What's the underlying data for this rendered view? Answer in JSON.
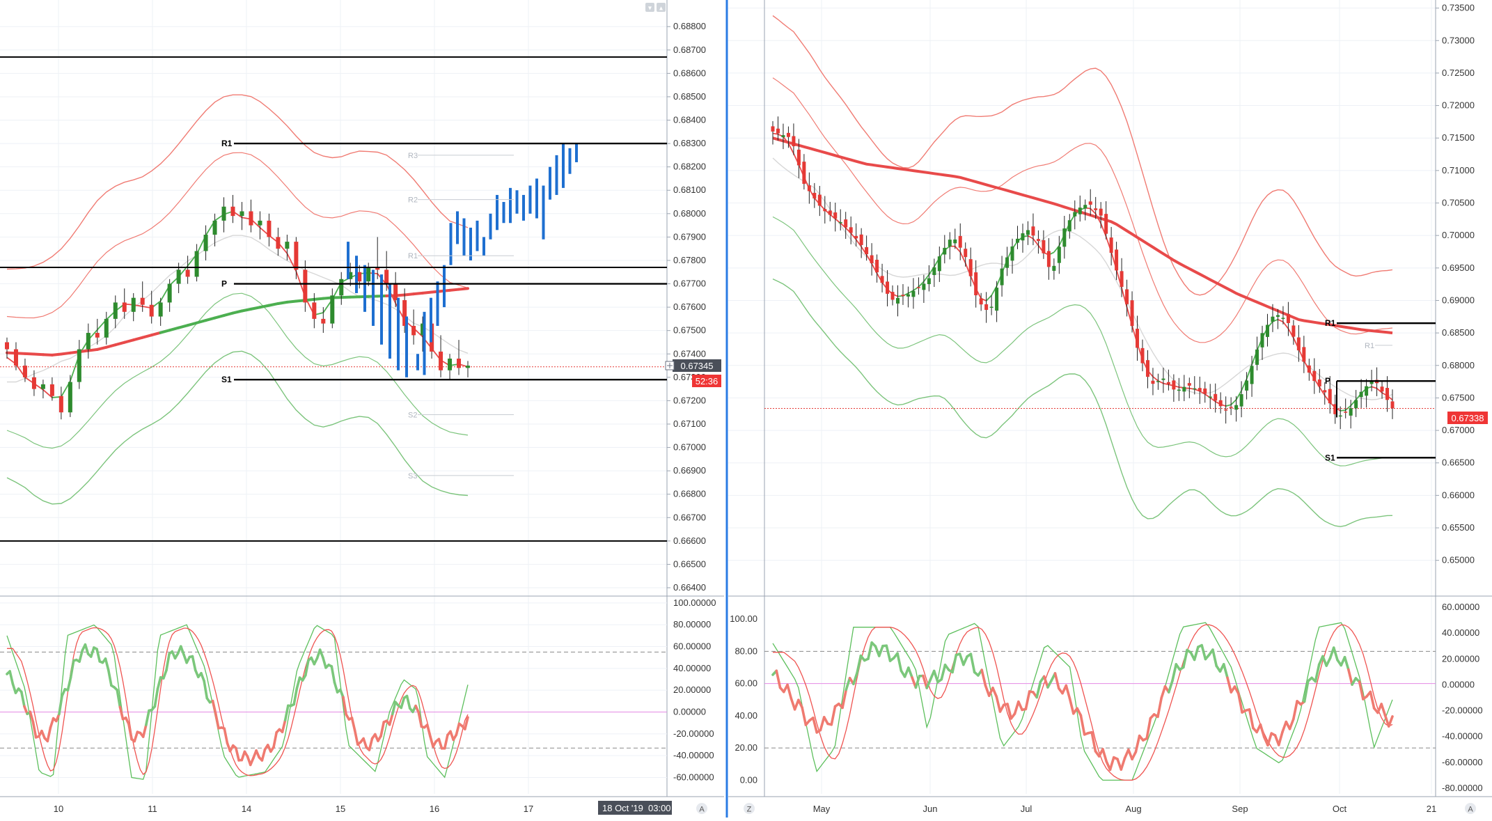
{
  "colors": {
    "background": "#ffffff",
    "grid": "#eef1f6",
    "bull_candle": "#2e8b2e",
    "bear_candle": "#e53935",
    "projection_bars": "#1e6fd0",
    "upper_band": "#f07b73",
    "lower_band": "#7cc47c",
    "ma_red": "#e84a4a",
    "ma_green": "#4caf50",
    "ma_grey": "#d7d7d7",
    "pivot_line": "#000000",
    "price_line": "#e53935",
    "osc_fast_green": "#5cbf5c",
    "osc_fast_red": "#ef5350",
    "osc_thick_green": "#7bc77b",
    "osc_thick_red": "#ef7a70",
    "dash_level": "#888888",
    "mid_level": "#e58ae5",
    "price_tag_bg": "#ef3535",
    "crosshair_tag_bg": "#4a4f59"
  },
  "left_chart": {
    "pair_price_tag": "0.67345",
    "countdown_tag": "52:36",
    "crosshair_time_tag": "18 Oct '19",
    "crosshair_time_sub": "03:00",
    "corner_buttons": [
      "▾",
      "▴"
    ],
    "footer_button": "A"
  },
  "right_chart": {
    "price_tag": "0.67338",
    "footer_left_button": "Z",
    "footer_right_button": "A"
  },
  "chart_data": [
    {
      "name_id": "left-price",
      "type": "line",
      "subtype": "candlestick",
      "x_tick_labels": [
        "10",
        "11",
        "14",
        "15",
        "16",
        "17"
      ],
      "y_tick_labels": [
        "0.68800",
        "0.68700",
        "0.68600",
        "0.68500",
        "0.68400",
        "0.68300",
        "0.68200",
        "0.68100",
        "0.68000",
        "0.67900",
        "0.67800",
        "0.67700",
        "0.67600",
        "0.67500",
        "0.67400",
        "0.67300",
        "0.67200",
        "0.67100",
        "0.67000",
        "0.66900",
        "0.66800",
        "0.66700",
        "0.66600",
        "0.66500",
        "0.66400"
      ],
      "ylim": [
        0.664,
        0.6889
      ],
      "last_price": 0.67345,
      "pivot_levels": [
        {
          "label": "R1",
          "value": 0.683
        },
        {
          "label": "P",
          "value": 0.677
        },
        {
          "label": "S1",
          "value": 0.6729
        }
      ],
      "faint_pivot_labels": [
        {
          "label": "R3",
          "value": 0.6825
        },
        {
          "label": "R2",
          "value": 0.6806
        },
        {
          "label": "R1",
          "value": 0.6782
        },
        {
          "label": "S2",
          "value": 0.6714
        },
        {
          "label": "S3",
          "value": 0.6688
        }
      ],
      "extra_lines": [
        0.6867,
        0.6777,
        0.666
      ],
      "candles_ohlc": [
        [
          0.6745,
          0.6747,
          0.6738,
          0.6742
        ],
        [
          0.6742,
          0.6745,
          0.6733,
          0.6735
        ],
        [
          0.6735,
          0.6738,
          0.6728,
          0.673
        ],
        [
          0.673,
          0.6733,
          0.6722,
          0.6725
        ],
        [
          0.6725,
          0.6729,
          0.6721,
          0.6727
        ],
        [
          0.6727,
          0.673,
          0.672,
          0.6722
        ],
        [
          0.6722,
          0.6726,
          0.6712,
          0.6715
        ],
        [
          0.6715,
          0.6731,
          0.6713,
          0.6728
        ],
        [
          0.6728,
          0.6746,
          0.6725,
          0.6742
        ],
        [
          0.6742,
          0.6753,
          0.6738,
          0.6749
        ],
        [
          0.6749,
          0.6755,
          0.6744,
          0.6747
        ],
        [
          0.6747,
          0.6758,
          0.6744,
          0.6755
        ],
        [
          0.6755,
          0.6765,
          0.6751,
          0.6762
        ],
        [
          0.6762,
          0.6768,
          0.6755,
          0.6758
        ],
        [
          0.6758,
          0.6766,
          0.6754,
          0.6764
        ],
        [
          0.6764,
          0.6771,
          0.6758,
          0.6761
        ],
        [
          0.6761,
          0.6767,
          0.6753,
          0.6756
        ],
        [
          0.6756,
          0.6764,
          0.6752,
          0.6762
        ],
        [
          0.6762,
          0.6772,
          0.6758,
          0.677
        ],
        [
          0.677,
          0.6779,
          0.6766,
          0.6776
        ],
        [
          0.6776,
          0.6782,
          0.677,
          0.6773
        ],
        [
          0.6773,
          0.6787,
          0.6771,
          0.6784
        ],
        [
          0.6784,
          0.6795,
          0.678,
          0.6791
        ],
        [
          0.6791,
          0.68,
          0.6786,
          0.6797
        ],
        [
          0.6797,
          0.6807,
          0.6792,
          0.6803
        ],
        [
          0.6803,
          0.6808,
          0.6796,
          0.6799
        ],
        [
          0.6799,
          0.6805,
          0.6793,
          0.6801
        ],
        [
          0.6801,
          0.6806,
          0.6792,
          0.6795
        ],
        [
          0.6795,
          0.6801,
          0.6789,
          0.6797
        ],
        [
          0.6797,
          0.68,
          0.6786,
          0.679
        ],
        [
          0.679,
          0.6794,
          0.6782,
          0.6785
        ],
        [
          0.6785,
          0.6791,
          0.678,
          0.6788
        ],
        [
          0.6788,
          0.679,
          0.6772,
          0.6776
        ],
        [
          0.6776,
          0.678,
          0.6758,
          0.6762
        ],
        [
          0.6762,
          0.6766,
          0.6751,
          0.6755
        ],
        [
          0.6755,
          0.676,
          0.6749,
          0.6753
        ],
        [
          0.6753,
          0.6768,
          0.6751,
          0.6765
        ],
        [
          0.6765,
          0.6775,
          0.6761,
          0.6772
        ],
        [
          0.6772,
          0.6779,
          0.6769,
          0.6775
        ],
        [
          0.6775,
          0.6778,
          0.6768,
          0.6771
        ],
        [
          0.6771,
          0.6779,
          0.6769,
          0.6777
        ],
        [
          0.6777,
          0.679,
          0.6772,
          0.6776
        ],
        [
          0.6776,
          0.6784,
          0.6767,
          0.677
        ],
        [
          0.677,
          0.6775,
          0.676,
          0.6763
        ],
        [
          0.6763,
          0.6768,
          0.6749,
          0.6752
        ],
        [
          0.6752,
          0.6759,
          0.6744,
          0.6748
        ],
        [
          0.6748,
          0.6756,
          0.6741,
          0.6753
        ],
        [
          0.6753,
          0.6757,
          0.6738,
          0.6741
        ],
        [
          0.6741,
          0.6748,
          0.673,
          0.6733
        ],
        [
          0.6733,
          0.674,
          0.6729,
          0.6738
        ],
        [
          0.6738,
          0.6746,
          0.6731,
          0.6734
        ],
        [
          0.6734,
          0.6737,
          0.673,
          0.6735
        ]
      ],
      "projection_bars": [
        [
          0.674,
          0.6733
        ],
        [
          0.6758,
          0.6731
        ],
        [
          0.6764,
          0.6745
        ],
        [
          0.6771,
          0.6752
        ],
        [
          0.6778,
          0.676
        ],
        [
          0.6796,
          0.6778
        ],
        [
          0.6801,
          0.6787
        ],
        [
          0.6798,
          0.6782
        ],
        [
          0.6794,
          0.678
        ],
        [
          0.6797,
          0.6784
        ],
        [
          0.679,
          0.6782
        ],
        [
          0.68,
          0.6789
        ],
        [
          0.6808,
          0.6793
        ],
        [
          0.6805,
          0.6796
        ],
        [
          0.6811,
          0.6796
        ],
        [
          0.681,
          0.68
        ],
        [
          0.6808,
          0.6797
        ],
        [
          0.6812,
          0.68
        ],
        [
          0.6815,
          0.6798
        ],
        [
          0.6812,
          0.6789
        ],
        [
          0.682,
          0.6806
        ],
        [
          0.6825,
          0.6808
        ],
        [
          0.683,
          0.6811
        ],
        [
          0.6828,
          0.6817
        ],
        [
          0.683,
          0.6822
        ]
      ]
    },
    {
      "name_id": "left-oscillator",
      "type": "line",
      "y_tick_labels": [
        "100.00000",
        "80.00000",
        "60.00000",
        "40.00000",
        "20.00000",
        "0.00000",
        "-20.00000",
        "-40.00000",
        "-60.00000"
      ],
      "ylim": [
        -75,
        105
      ],
      "dashed_levels": [
        55,
        -33
      ],
      "mid_level": 0
    },
    {
      "name_id": "right-price",
      "type": "line",
      "subtype": "candlestick",
      "x_tick_labels": [
        "May",
        "Jun",
        "Jul",
        "Aug",
        "Sep",
        "Oct",
        "21"
      ],
      "y_tick_labels": [
        "0.73500",
        "0.73000",
        "0.72500",
        "0.72000",
        "0.71500",
        "0.71000",
        "0.70500",
        "0.70000",
        "0.69500",
        "0.69000",
        "0.68500",
        "0.68000",
        "0.67500",
        "0.67000",
        "0.66500",
        "0.66000",
        "0.65500",
        "0.65000"
      ],
      "ylim": [
        0.646,
        0.7356
      ],
      "last_price": 0.67338,
      "pivot_levels": [
        {
          "label": "R1",
          "value": 0.6865
        },
        {
          "label": "P",
          "value": 0.6776
        },
        {
          "label": "S1",
          "value": 0.6658
        }
      ],
      "faint_pivot_labels": [
        {
          "label": "R1",
          "value": 0.6831
        }
      ]
    },
    {
      "name_id": "right-oscillator",
      "type": "line",
      "y_tick_labels_left": [
        "100.00",
        "80.00",
        "60.00",
        "40.00",
        "20.00",
        "0.00"
      ],
      "y_tick_labels_right": [
        "60.00000",
        "40.00000",
        "20.00000",
        "0.00000",
        "-20.00000",
        "-40.00000",
        "-60.00000",
        "-80.00000"
      ],
      "ylim": [
        -5,
        110
      ],
      "dashed_levels": [
        80,
        20
      ],
      "mid_level": 60
    }
  ]
}
